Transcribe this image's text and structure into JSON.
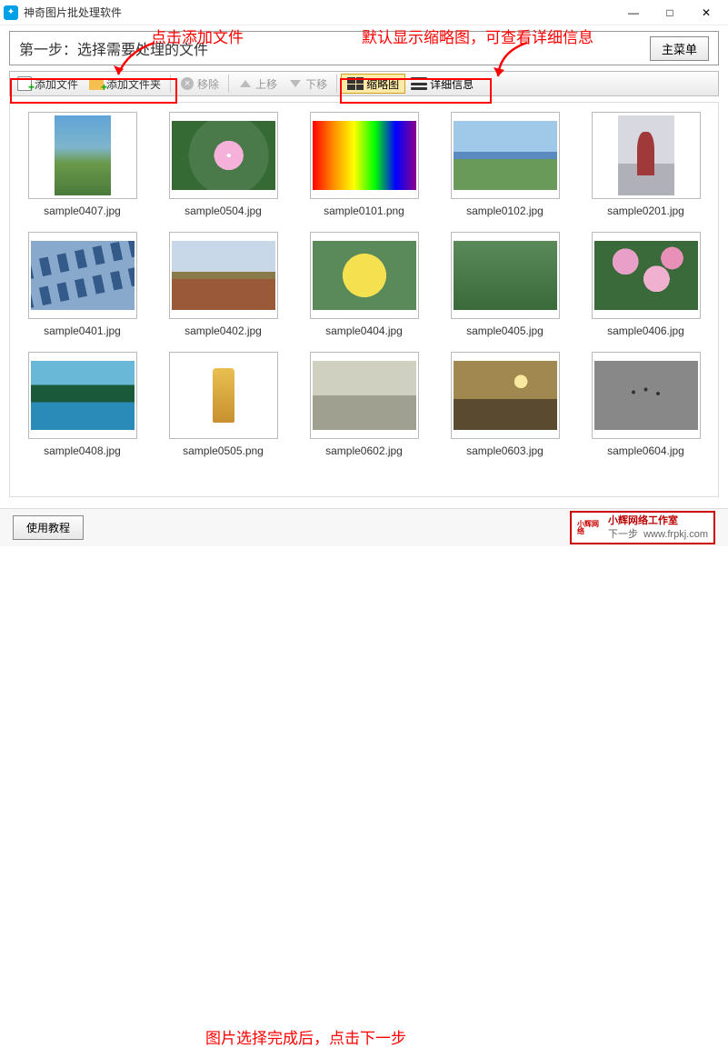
{
  "titlebar": {
    "app_title": "神奇图片批处理软件"
  },
  "window_controls": {
    "minimize": "—",
    "maximize": "□",
    "close": "✕"
  },
  "step": {
    "title": "第一步：选择需要处理的文件",
    "main_menu": "主菜单"
  },
  "toolbar": {
    "add_file": "添加文件",
    "add_folder": "添加文件夹",
    "remove": "移除",
    "move_up": "上移",
    "move_down": "下移",
    "thumbnail": "缩略图",
    "details": "详细信息"
  },
  "annotations": {
    "click_add": "点击添加文件",
    "default_thumb": "默认显示缩略图，可查看详细信息",
    "after_select": "图片选择完成后，点击下一步"
  },
  "files": [
    {
      "name": "sample0407.jpg",
      "cls": "s0407"
    },
    {
      "name": "sample0504.jpg",
      "cls": "s0504"
    },
    {
      "name": "sample0101.png",
      "cls": "s0101"
    },
    {
      "name": "sample0102.jpg",
      "cls": "s0102"
    },
    {
      "name": "sample0201.jpg",
      "cls": "s0201"
    },
    {
      "name": "sample0401.jpg",
      "cls": "s0401"
    },
    {
      "name": "sample0402.jpg",
      "cls": "s0402"
    },
    {
      "name": "sample0404.jpg",
      "cls": "s0404"
    },
    {
      "name": "sample0405.jpg",
      "cls": "s0405"
    },
    {
      "name": "sample0406.jpg",
      "cls": "s0406"
    },
    {
      "name": "sample0408.jpg",
      "cls": "s0408"
    },
    {
      "name": "sample0505.png",
      "cls": "s0505"
    },
    {
      "name": "sample0602.jpg",
      "cls": "s0602"
    },
    {
      "name": "sample0603.jpg",
      "cls": "s0603"
    },
    {
      "name": "sample0604.jpg",
      "cls": "s0604"
    }
  ],
  "footer": {
    "tutorial": "使用教程",
    "next": "下一步",
    "watermark": {
      "brand": "小辉网络",
      "line1": "小辉网络工作室",
      "line2": "www.frpkj.com"
    }
  }
}
